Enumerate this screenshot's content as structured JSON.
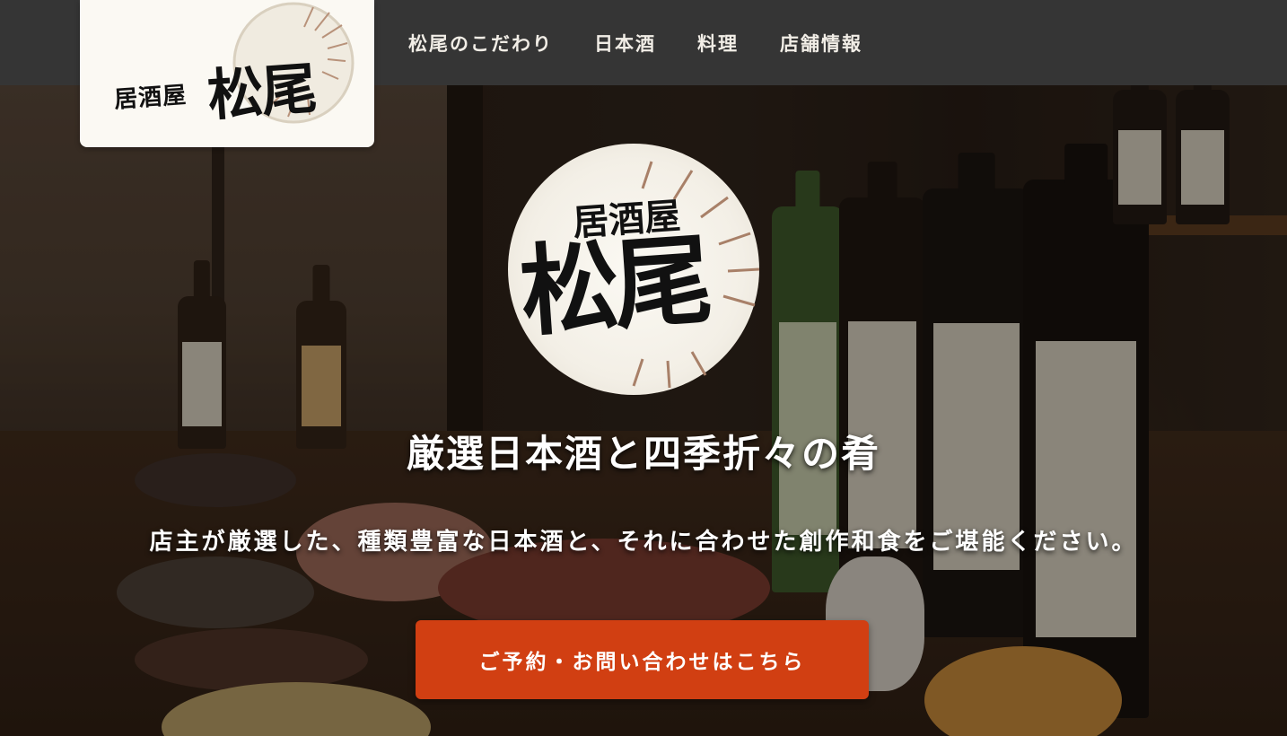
{
  "brand": {
    "logo_prefix": "居酒屋",
    "logo_main": "松尾"
  },
  "nav": {
    "items": [
      {
        "label": "松尾のこだわり"
      },
      {
        "label": "日本酒"
      },
      {
        "label": "料理"
      },
      {
        "label": "店舗情報"
      }
    ]
  },
  "hero": {
    "logo_prefix": "居酒屋",
    "logo_main": "松尾",
    "title": "厳選日本酒と四季折々の肴",
    "subtitle": "店主が厳選した、種類豊富な日本酒と、それに合わせた創作和食をご堪能ください。",
    "cta_label": "ご予約・お問い合わせはこちら"
  },
  "colors": {
    "header_bg": "#353535",
    "cta_bg": "#d13f12",
    "logo_card_bg": "#fbf9f3"
  }
}
